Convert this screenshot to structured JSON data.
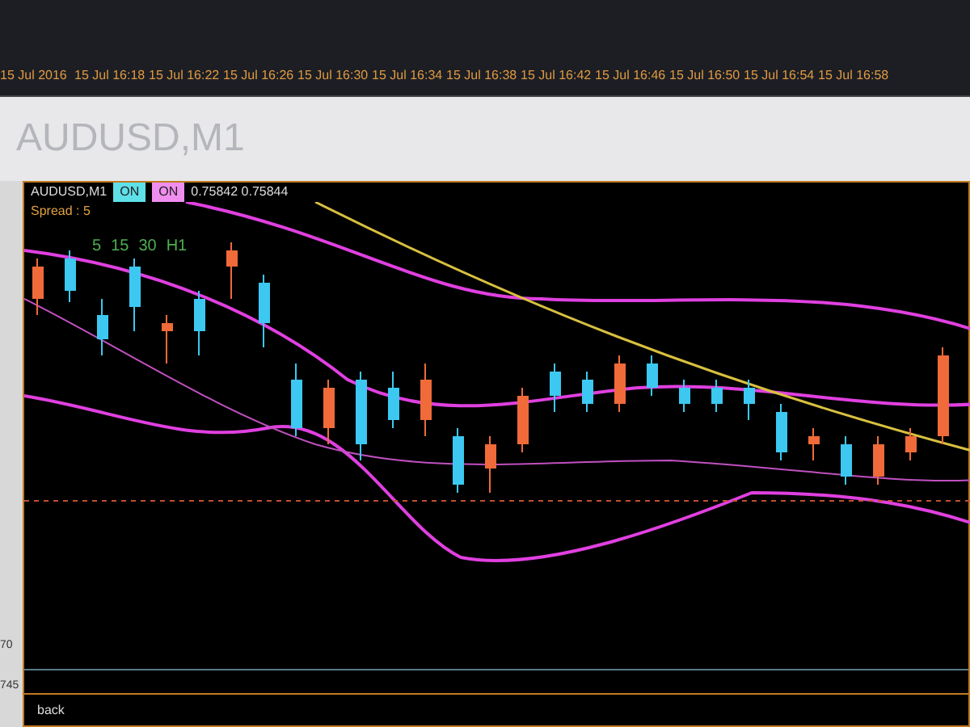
{
  "time_axis": {
    "labels": [
      "15 Jul 2016",
      "15 Jul 16:18",
      "15 Jul 16:22",
      "15 Jul 16:26",
      "15 Jul 16:30",
      "15 Jul 16:34",
      "15 Jul 16:38",
      "15 Jul 16:42",
      "15 Jul 16:46",
      "15 Jul 16:50",
      "15 Jul 16:54",
      "15 Jul 16:58"
    ]
  },
  "window": {
    "title": "AUDUSD,M1"
  },
  "chart": {
    "symbol": "AUDUSD,M1",
    "badges": [
      {
        "label": "ON",
        "color": "#5ee0e8"
      },
      {
        "label": "ON",
        "color": "#f08ef0"
      }
    ],
    "prices": "0.75842 0.75844",
    "spread": "Spread : 5",
    "timeframes": [
      "5",
      "15",
      "30",
      "H1"
    ]
  },
  "price_axis": [
    "70",
    "745"
  ],
  "bottom_tab": {
    "label": "back"
  }
}
